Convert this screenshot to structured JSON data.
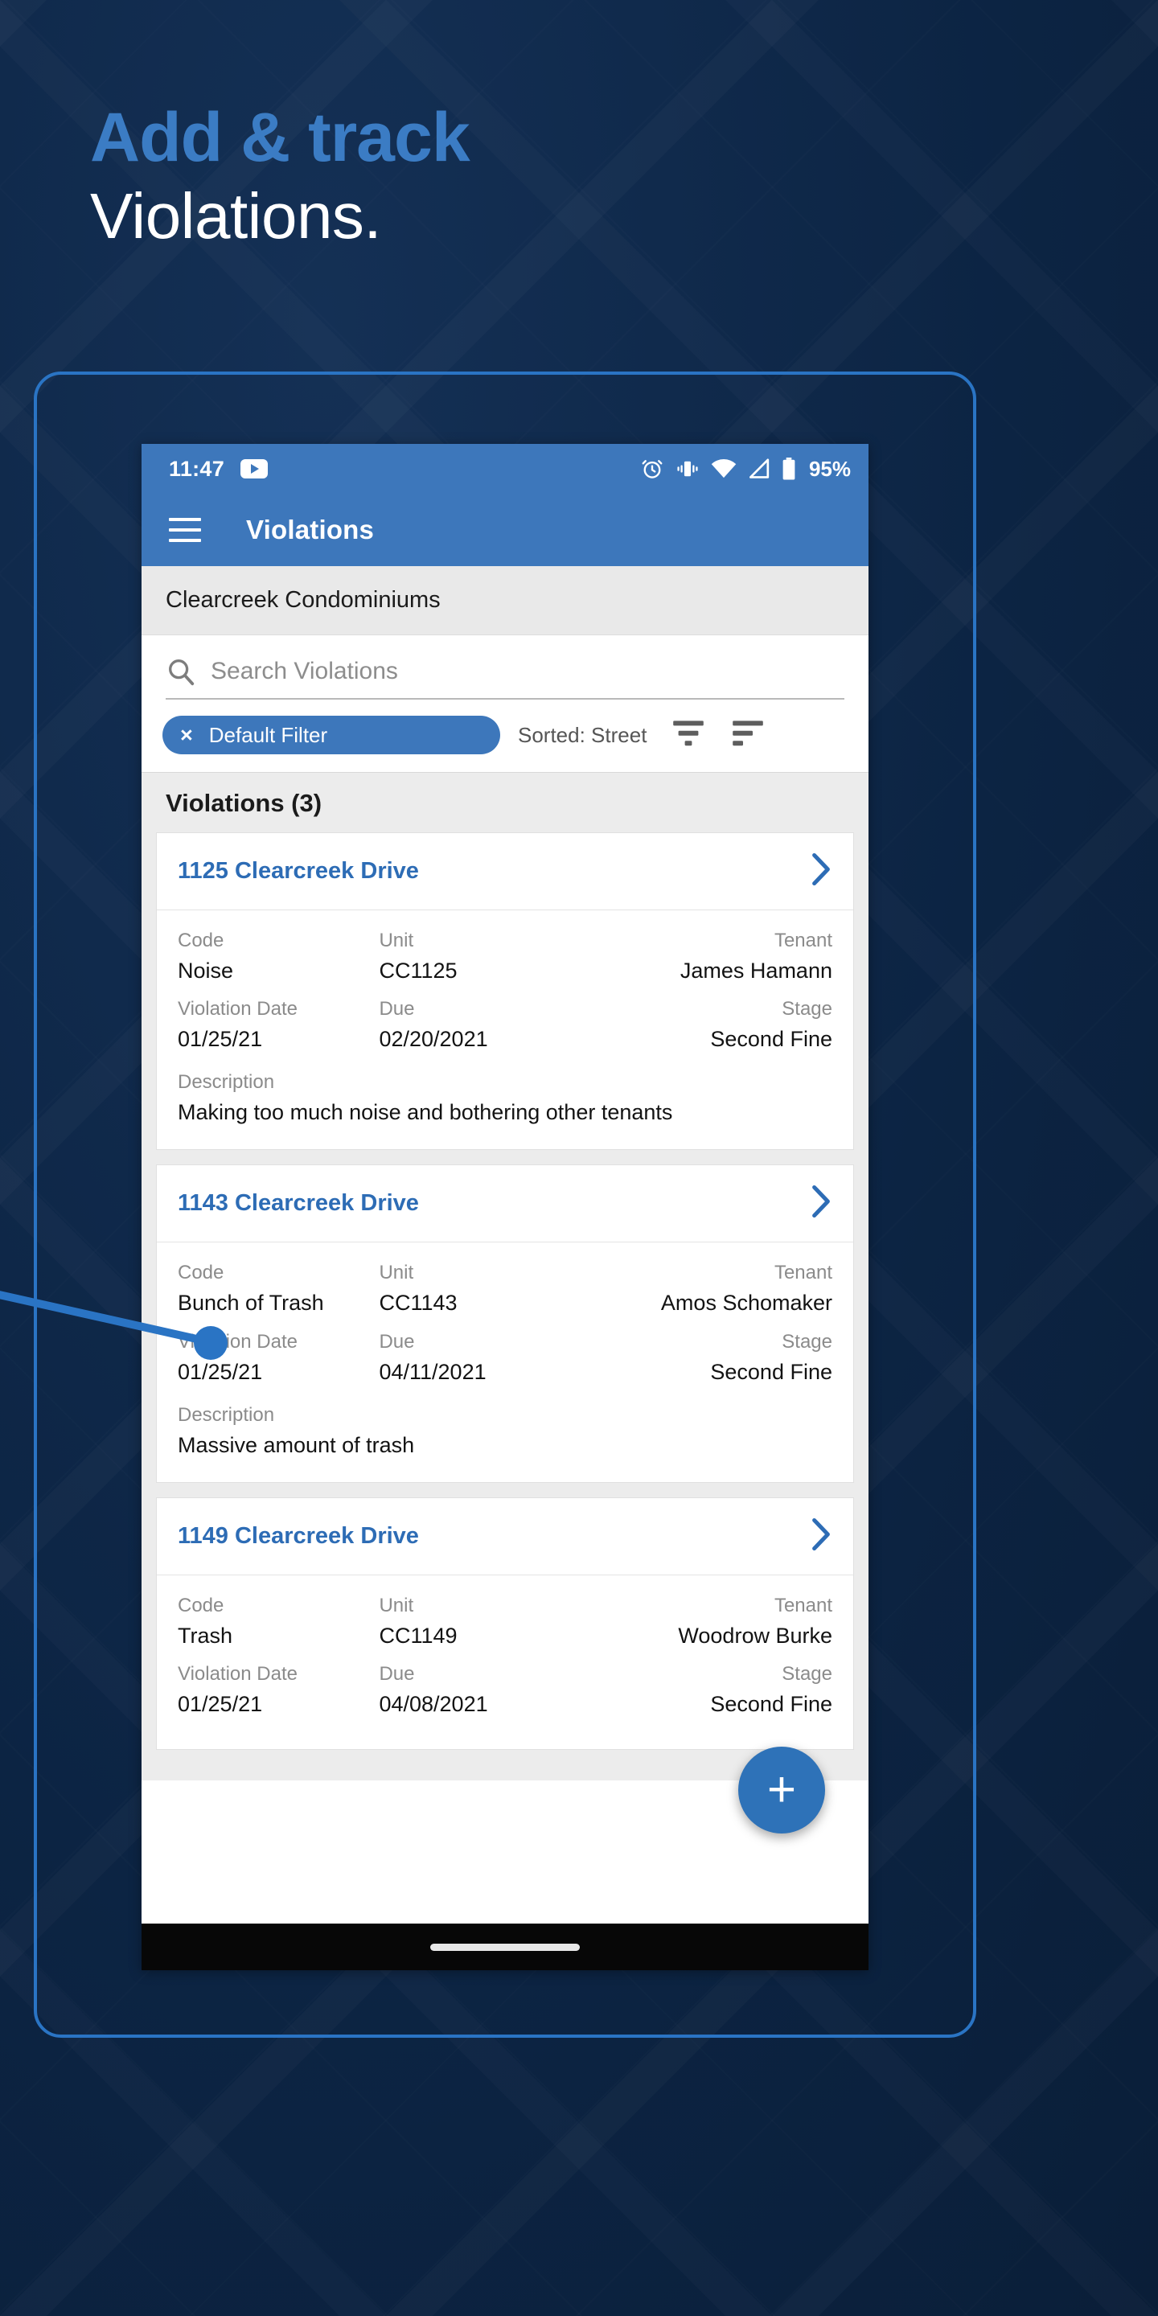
{
  "promo": {
    "headline_line1": "Add & track",
    "headline_line2": "Violations."
  },
  "colors": {
    "background": "#0d2847",
    "accent_blue": "#3b7cc4",
    "appbar_blue": "#3d77bb",
    "link_blue": "#2d6cb5",
    "fab_blue": "#2e72b8"
  },
  "phone": {
    "statusbar": {
      "time": "11:47",
      "app_icon": "youtube-icon",
      "icons": [
        "alarm-icon",
        "vibrate-icon",
        "wifi-icon",
        "cell-signal-icon",
        "battery-icon"
      ],
      "battery_percent": "95%"
    },
    "appbar": {
      "menu_icon": "hamburger-menu-icon",
      "title": "Violations"
    },
    "org_name": "Clearcreek Condominiums",
    "search": {
      "icon": "search-icon",
      "placeholder": "Search Violations",
      "value": ""
    },
    "filter": {
      "chip_close": "×",
      "chip_label": "Default Filter",
      "sorted_label": "Sorted: Street",
      "filter_icon": "filter-funnel-icon",
      "sort_icon": "sort-lines-icon"
    },
    "list_header": "Violations (3)",
    "field_labels": {
      "code": "Code",
      "unit": "Unit",
      "tenant": "Tenant",
      "violation_date": "Violation Date",
      "due": "Due",
      "stage": "Stage",
      "description": "Description"
    },
    "violations": [
      {
        "address": "1125 Clearcreek Drive",
        "code": "Noise",
        "unit": "CC1125",
        "tenant": "James Hamann",
        "violation_date": "01/25/21",
        "due": "02/20/2021",
        "stage": "Second Fine",
        "description": "Making too much noise and bothering other tenants"
      },
      {
        "address": "1143 Clearcreek Drive",
        "code": "Bunch of Trash",
        "unit": "CC1143",
        "tenant": "Amos Schomaker",
        "violation_date": "01/25/21",
        "due": "04/11/2021",
        "stage": "Second Fine",
        "description": "Massive amount of trash"
      },
      {
        "address": "1149 Clearcreek Drive",
        "code": "Trash",
        "unit": "CC1149",
        "tenant": "Woodrow Burke",
        "violation_date": "01/25/21",
        "due": "04/08/2021",
        "stage": "Second Fine",
        "description": ""
      }
    ],
    "fab_label": "+",
    "nav_home_indicator": "home-indicator"
  }
}
